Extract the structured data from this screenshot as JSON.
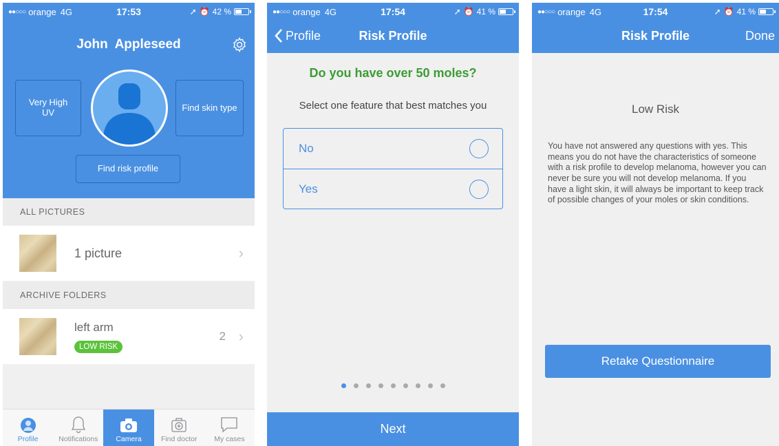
{
  "status_bars": [
    {
      "carrier": "orange",
      "network": "4G",
      "time": "17:53",
      "battery": "42 %"
    },
    {
      "carrier": "orange",
      "network": "4G",
      "time": "17:54",
      "battery": "41 %"
    },
    {
      "carrier": "orange",
      "network": "4G",
      "time": "17:54",
      "battery": "41 %"
    }
  ],
  "profile": {
    "user_name": "John  Appleseed",
    "uv_label_1": "Very High",
    "uv_label_2": "UV",
    "find_skin_type": "Find skin type",
    "find_risk_profile": "Find risk profile",
    "all_pictures_header": "ALL PICTURES",
    "pictures_count": "1 picture",
    "archive_header": "ARCHIVE FOLDERS",
    "folder_name": "left arm",
    "folder_badge": "LOW RISK",
    "folder_count": "2",
    "colors": {
      "primary": "#4a90e2",
      "badge": "#5cc23c"
    }
  },
  "tabs": [
    {
      "label": "Profile",
      "icon": "person-icon"
    },
    {
      "label": "Notifications",
      "icon": "bell-icon"
    },
    {
      "label": "Camera",
      "icon": "camera-icon"
    },
    {
      "label": "Find doctor",
      "icon": "medical-kit-icon"
    },
    {
      "label": "My cases",
      "icon": "chat-bubble-icon"
    }
  ],
  "questionnaire": {
    "back_label": "Profile",
    "title": "Risk Profile",
    "question": "Do you have over 50 moles?",
    "instruction": "Select one feature that best matches you",
    "options": [
      "No",
      "Yes"
    ],
    "next_label": "Next",
    "page_count": 9,
    "current_page": 1
  },
  "result": {
    "title": "Risk Profile",
    "done_label": "Done",
    "risk_level": "Low Risk",
    "description": "You have not answered any questions with yes. This means you do not have the characteristics of someone with a risk profile to develop melanoma, however you can never be sure you will not develop melanoma. If you have a light skin, it will always be important to keep track of possible changes of your moles or skin conditions.",
    "retake_label": "Retake Questionnaire"
  }
}
